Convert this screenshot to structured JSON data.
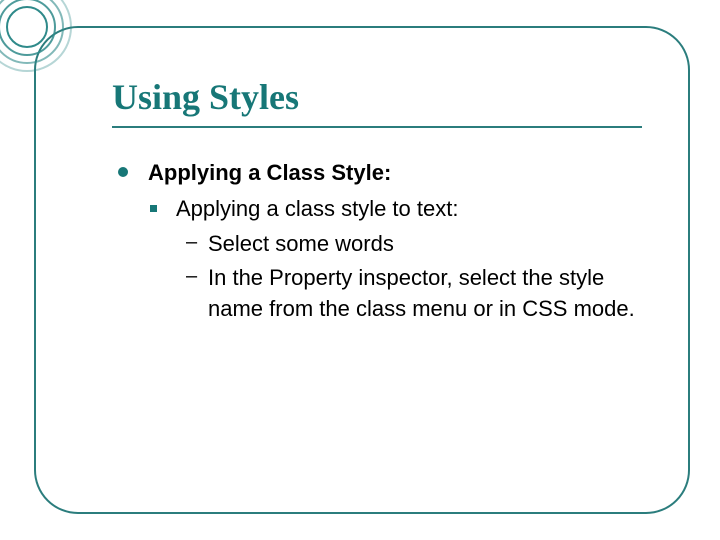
{
  "slide": {
    "title": "Using Styles",
    "bullets": {
      "l1": "Applying a Class Style:",
      "l2": "Applying a class style to text:",
      "l3a": "Select  some words",
      "l3b": "In the Property inspector, select the style name from the class menu or in CSS mode."
    }
  }
}
